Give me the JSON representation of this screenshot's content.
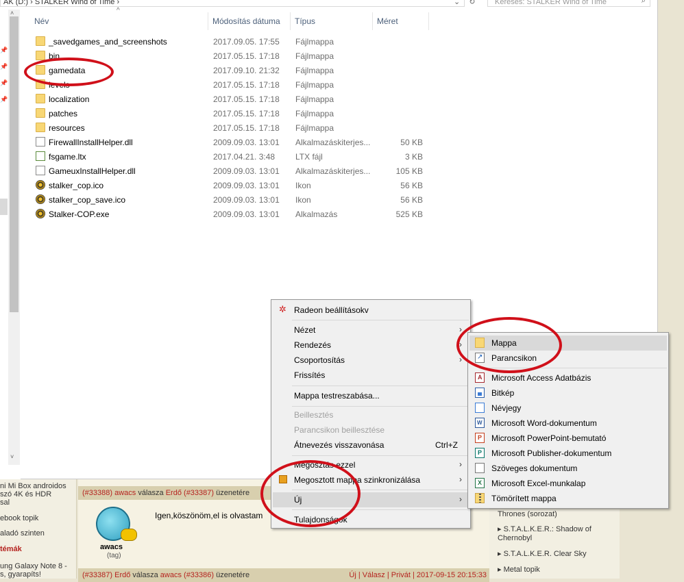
{
  "address": {
    "path": "AK (D:)  ›  STALKER Wind of Time  ›",
    "refresh": "↻",
    "dropdown": "⌄"
  },
  "search": {
    "placeholder": "Keresés: STALKER Wind of Time"
  },
  "columns": {
    "name": "Név",
    "modified": "Módosítás dátuma",
    "type": "Típus",
    "size": "Méret",
    "sort_indicator": "^"
  },
  "files": [
    {
      "name": "_savedgames_and_screenshots",
      "modified": "2017.09.05. 17:55",
      "type": "Fájlmappa",
      "size": "",
      "icon": "folder"
    },
    {
      "name": "bin",
      "modified": "2017.05.15. 17:18",
      "type": "Fájlmappa",
      "size": "",
      "icon": "folder"
    },
    {
      "name": "gamedata",
      "modified": "2017.09.10. 21:32",
      "type": "Fájlmappa",
      "size": "",
      "icon": "folder"
    },
    {
      "name": "levels",
      "modified": "2017.05.15. 17:18",
      "type": "Fájlmappa",
      "size": "",
      "icon": "folder"
    },
    {
      "name": "localization",
      "modified": "2017.05.15. 17:18",
      "type": "Fájlmappa",
      "size": "",
      "icon": "folder"
    },
    {
      "name": "patches",
      "modified": "2017.05.15. 17:18",
      "type": "Fájlmappa",
      "size": "",
      "icon": "folder"
    },
    {
      "name": "resources",
      "modified": "2017.05.15. 17:18",
      "type": "Fájlmappa",
      "size": "",
      "icon": "folder"
    },
    {
      "name": "FirewallInstallHelper.dll",
      "modified": "2009.09.03. 13:01",
      "type": "Alkalmazáskiterjes...",
      "size": "50 KB",
      "icon": "file"
    },
    {
      "name": "fsgame.ltx",
      "modified": "2017.04.21. 3:48",
      "type": "LTX fájl",
      "size": "3 KB",
      "icon": "ltx"
    },
    {
      "name": "GameuxInstallHelper.dll",
      "modified": "2009.09.03. 13:01",
      "type": "Alkalmazáskiterjes...",
      "size": "105 KB",
      "icon": "file"
    },
    {
      "name": "stalker_cop.ico",
      "modified": "2009.09.03. 13:01",
      "type": "Ikon",
      "size": "56 KB",
      "icon": "radio"
    },
    {
      "name": "stalker_cop_save.ico",
      "modified": "2009.09.03. 13:01",
      "type": "Ikon",
      "size": "56 KB",
      "icon": "radio"
    },
    {
      "name": "Stalker-COP.exe",
      "modified": "2009.09.03. 13:01",
      "type": "Alkalmazás",
      "size": "525 KB",
      "icon": "radio"
    }
  ],
  "context_menu": {
    "radeon": "Radeon beállításokv",
    "view": "Nézet",
    "sort": "Rendezés",
    "group": "Csoportosítás",
    "refresh": "Frissítés",
    "customize": "Mappa testreszabása...",
    "paste": "Beillesztés",
    "paste_shortcut": "Parancsikon beillesztése",
    "undo_rename": "Átnevezés visszavonása",
    "undo_shortcut": "Ctrl+Z",
    "share": "Megosztás ezzel",
    "sync": "Megosztott mappa szinkronizálása",
    "new": "Új",
    "properties": "Tulajdonságok"
  },
  "new_submenu": {
    "folder": "Mappa",
    "shortcut": "Parancsikon",
    "items": [
      {
        "label": "Microsoft Access Adatbázis",
        "icon": "access-icon"
      },
      {
        "label": "Bitkép",
        "icon": "bitmap-icon"
      },
      {
        "label": "Névjegy",
        "icon": "contact-icon"
      },
      {
        "label": "Microsoft Word-dokumentum",
        "icon": "word-icon"
      },
      {
        "label": "Microsoft PowerPoint-bemutató",
        "icon": "powerpoint-icon"
      },
      {
        "label": "Microsoft Publisher-dokumentum",
        "icon": "publisher-icon"
      },
      {
        "label": "Szöveges dokumentum",
        "icon": "text-icon"
      },
      {
        "label": "Microsoft Excel-munkalap",
        "icon": "excel-icon"
      },
      {
        "label": "Tömörített mappa",
        "icon": "zip-icon"
      }
    ]
  },
  "forum": {
    "left": [
      "ni Mi Box androidos",
      "szó 4K és HDR",
      "sal",
      "ebook topik",
      "aladó szinten",
      "témák",
      "ung Galaxy Note 8 -",
      "s, gyarapíts!"
    ],
    "post1_id": "(#33388)",
    "post1_user": "awacs",
    "post1_mid": " válasza ",
    "post1_to": "Erdő",
    "post1_ref": "(#33387)",
    "post1_end": " üzenetére",
    "post_text": "Igen,köszönöm,el is olvastam",
    "username": "awacs",
    "usertag": "(tag)",
    "post2_id": "(#33387)",
    "post2_user": "Erdő",
    "post2_mid": " válasza ",
    "post2_to": "awacs",
    "post2_ref": "(#33386)",
    "post2_end": " üzenetére",
    "post2_actions": "Új | Válasz | Privát | 2017-09-15 20:15:33",
    "right": [
      "Thrones (sorozat)",
      "▸ S.T.A.L.K.E.R.: Shadow of Chernobyl",
      "▸ S.T.A.L.K.E.R. Clear Sky",
      "▸ Metal topik"
    ]
  },
  "colors": {
    "annotation": "#d0101a",
    "menu_bg": "#f0f0f0",
    "highlight": "#d9d9d9"
  }
}
